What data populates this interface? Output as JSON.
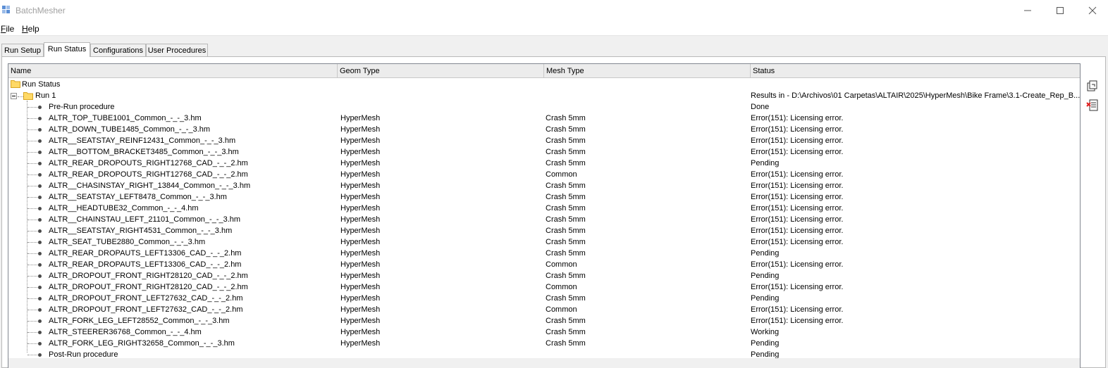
{
  "window": {
    "title": "BatchMesher",
    "app_icon": "mesh-app-icon",
    "controls": [
      "minimize-icon",
      "maximize-icon",
      "close-icon"
    ]
  },
  "menu": {
    "file_accel": "F",
    "file_rest": "ile",
    "help_accel": "H",
    "help_rest": "elp"
  },
  "tabs": [
    {
      "label": "Run Setup",
      "active": false
    },
    {
      "label": "Run Status",
      "active": true
    },
    {
      "label": "Configurations",
      "active": false
    },
    {
      "label": "User Procedures",
      "active": false
    }
  ],
  "columns": {
    "name": "Name",
    "geom": "Geom Type",
    "mesh": "Mesh Type",
    "status": "Status"
  },
  "tree": {
    "root_label": "Run Status",
    "run_label": "Run 1",
    "run_status": "Results in - D:\\Archivos\\01 Carpetas\\ALTAIR\\2025\\HyperMesh\\Bike Frame\\3.1-Create_Rep_B...",
    "items": [
      {
        "name": "Pre-Run procedure",
        "geom": "",
        "mesh": "",
        "status": "Done"
      },
      {
        "name": "ALTR_TOP_TUBE1001_Common_-_-_3.hm",
        "geom": "HyperMesh",
        "mesh": "Crash 5mm",
        "status": "Error(151): Licensing error."
      },
      {
        "name": "ALTR_DOWN_TUBE1485_Common_-_-_3.hm",
        "geom": "HyperMesh",
        "mesh": "Crash 5mm",
        "status": "Error(151): Licensing error."
      },
      {
        "name": "ALTR__SEATSTAY_REINF12431_Common_-_-_3.hm",
        "geom": "HyperMesh",
        "mesh": "Crash 5mm",
        "status": "Error(151): Licensing error."
      },
      {
        "name": "ALTR__BOTTOM_BRACKET3485_Common_-_-_3.hm",
        "geom": "HyperMesh",
        "mesh": "Crash 5mm",
        "status": "Error(151): Licensing error."
      },
      {
        "name": "ALTR_REAR_DROPOUTS_RIGHT12768_CAD_-_-_2.hm",
        "geom": "HyperMesh",
        "mesh": "Crash 5mm",
        "status": "Pending"
      },
      {
        "name": "ALTR_REAR_DROPOUTS_RIGHT12768_CAD_-_-_2.hm",
        "geom": "HyperMesh",
        "mesh": "Common",
        "status": "Error(151): Licensing error."
      },
      {
        "name": "ALTR__CHASINSTAY_RIGHT_13844_Common_-_-_3.hm",
        "geom": "HyperMesh",
        "mesh": "Crash 5mm",
        "status": "Error(151): Licensing error."
      },
      {
        "name": "ALTR__SEATSTAY_LEFT8478_Common_-_-_3.hm",
        "geom": "HyperMesh",
        "mesh": "Crash 5mm",
        "status": "Error(151): Licensing error."
      },
      {
        "name": "ALTR__HEADTUBE32_Common_-_-_4.hm",
        "geom": "HyperMesh",
        "mesh": "Crash 5mm",
        "status": "Error(151): Licensing error."
      },
      {
        "name": "ALTR__CHAINSTAU_LEFT_21101_Common_-_-_3.hm",
        "geom": "HyperMesh",
        "mesh": "Crash 5mm",
        "status": "Error(151): Licensing error."
      },
      {
        "name": "ALTR__SEATSTAY_RIGHT4531_Common_-_-_3.hm",
        "geom": "HyperMesh",
        "mesh": "Crash 5mm",
        "status": "Error(151): Licensing error."
      },
      {
        "name": "ALTR_SEAT_TUBE2880_Common_-_-_3.hm",
        "geom": "HyperMesh",
        "mesh": "Crash 5mm",
        "status": "Error(151): Licensing error."
      },
      {
        "name": "ALTR_REAR_DROPAUTS_LEFT13306_CAD_-_-_2.hm",
        "geom": "HyperMesh",
        "mesh": "Crash 5mm",
        "status": "Pending"
      },
      {
        "name": "ALTR_REAR_DROPAUTS_LEFT13306_CAD_-_-_2.hm",
        "geom": "HyperMesh",
        "mesh": "Common",
        "status": "Error(151): Licensing error."
      },
      {
        "name": "ALTR_DROPOUT_FRONT_RIGHT28120_CAD_-_-_2.hm",
        "geom": "HyperMesh",
        "mesh": "Crash 5mm",
        "status": "Pending"
      },
      {
        "name": "ALTR_DROPOUT_FRONT_RIGHT28120_CAD_-_-_2.hm",
        "geom": "HyperMesh",
        "mesh": "Common",
        "status": "Error(151): Licensing error."
      },
      {
        "name": "ALTR_DROPOUT_FRONT_LEFT27632_CAD_-_-_2.hm",
        "geom": "HyperMesh",
        "mesh": "Crash 5mm",
        "status": "Pending"
      },
      {
        "name": "ALTR_DROPOUT_FRONT_LEFT27632_CAD_-_-_2.hm",
        "geom": "HyperMesh",
        "mesh": "Common",
        "status": "Error(151): Licensing error."
      },
      {
        "name": "ALTR_FORK_LEG_LEFT28552_Common_-_-_3.hm",
        "geom": "HyperMesh",
        "mesh": "Crash 5mm",
        "status": "Error(151): Licensing error."
      },
      {
        "name": "ALTR_STEERER36768_Common_-_-_4.hm",
        "geom": "HyperMesh",
        "mesh": "Crash 5mm",
        "status": "Working"
      },
      {
        "name": "ALTR_FORK_LEG_RIGHT32658_Common_-_-_3.hm",
        "geom": "HyperMesh",
        "mesh": "Crash 5mm",
        "status": "Pending"
      },
      {
        "name": "Post-Run procedure",
        "geom": "",
        "mesh": "",
        "status": "Pending"
      }
    ]
  },
  "side_buttons": [
    "refresh-run-icon",
    "remove-run-icon"
  ],
  "colors": {
    "folder": "#ffd966",
    "folder_edge": "#d9a521",
    "accent": "#0078d7"
  }
}
